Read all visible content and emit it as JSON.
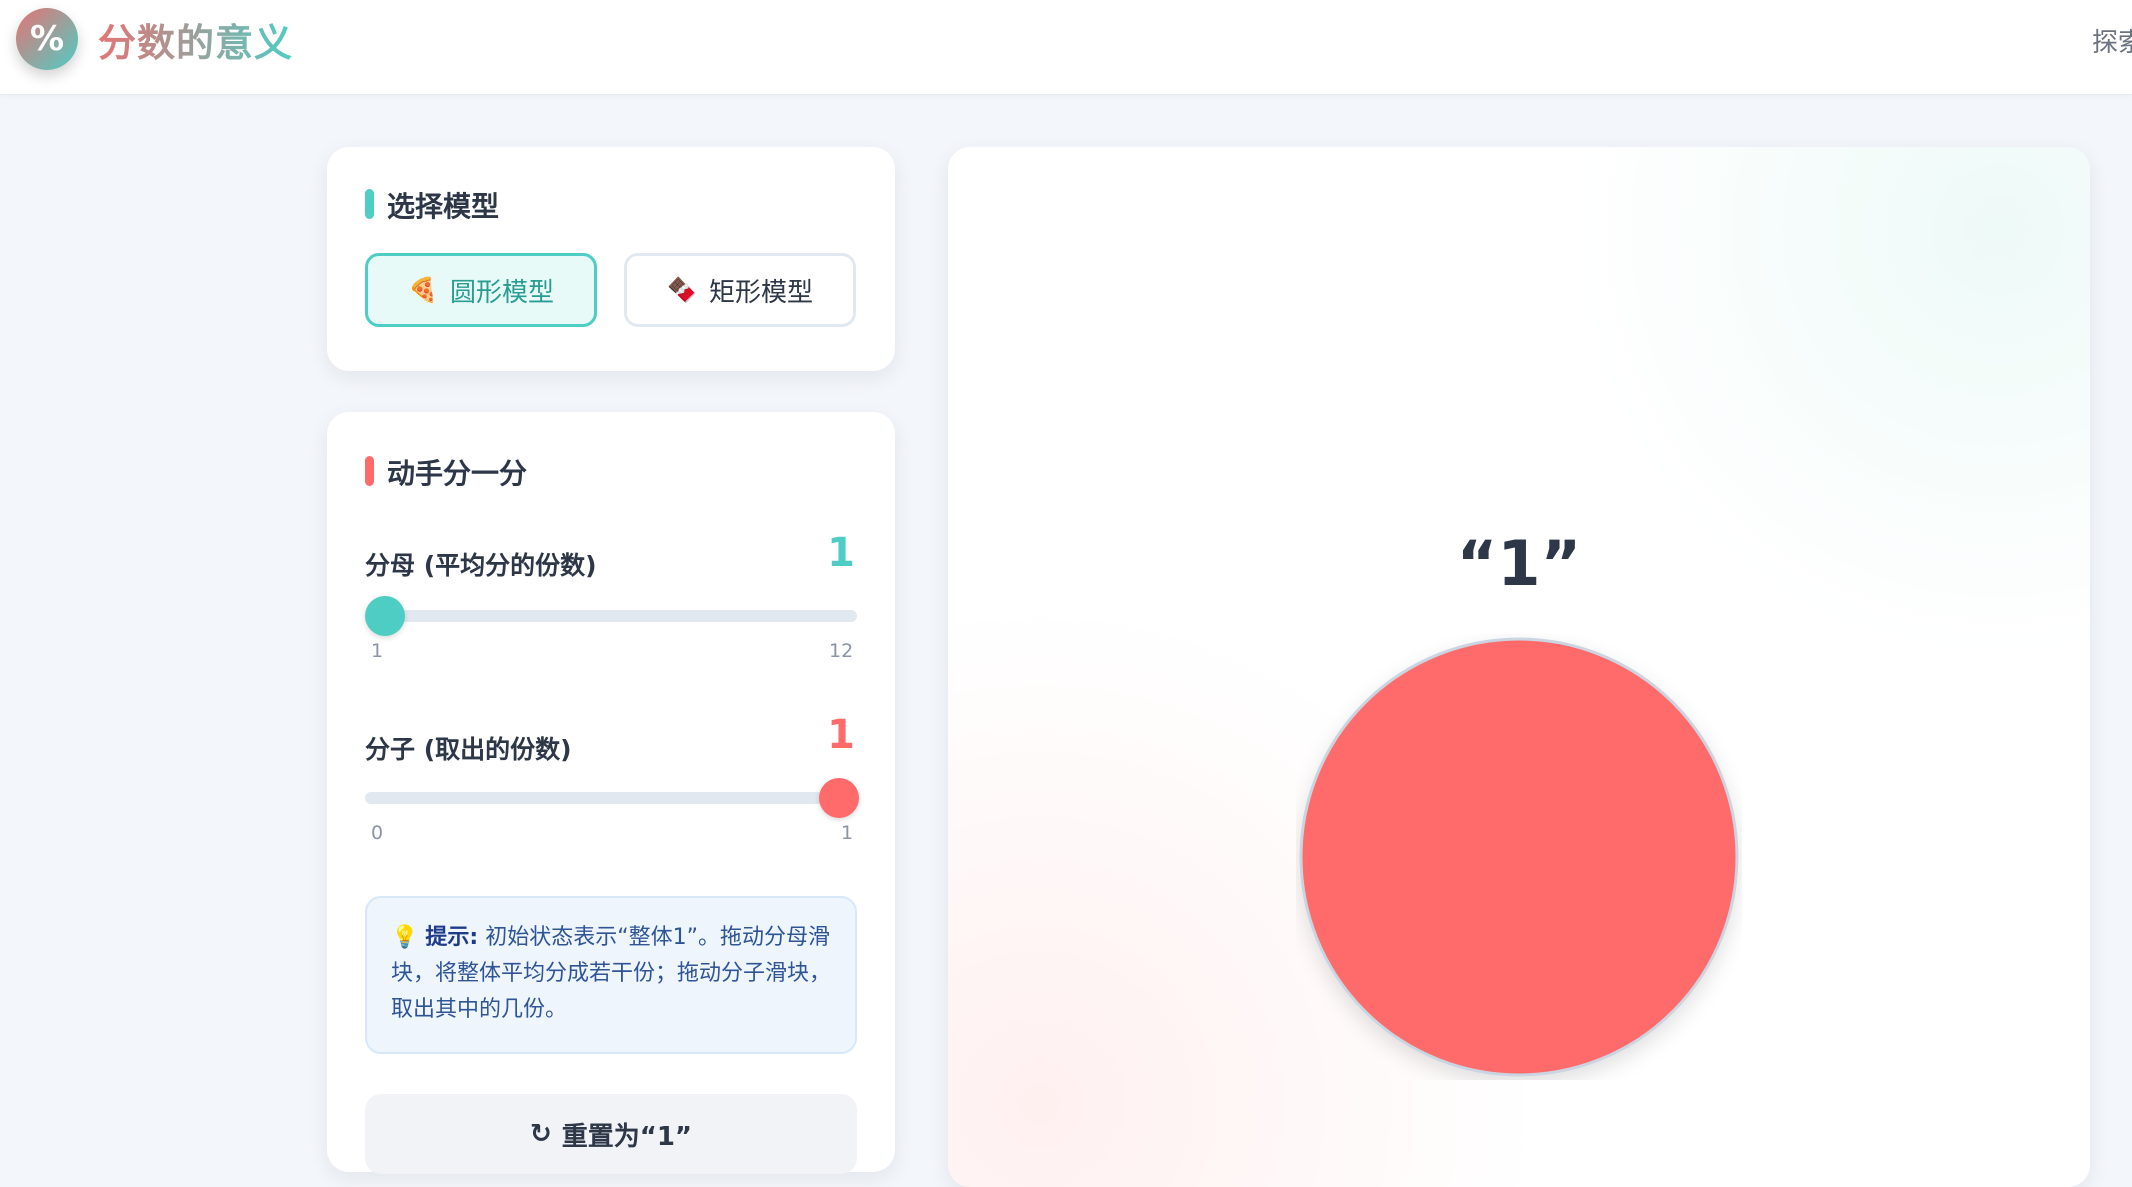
{
  "header": {
    "logo_symbol": "%",
    "title": "分数的意义",
    "nav_link": "探索"
  },
  "model_card": {
    "title": "选择模型",
    "accent_color": "#4ecdc4",
    "buttons": [
      {
        "label": "圆形模型",
        "icon": "pizza-icon",
        "glyph": "🍕",
        "active": true
      },
      {
        "label": "矩形模型",
        "icon": "chocolate-icon",
        "glyph": "🍫",
        "active": false
      }
    ]
  },
  "divide_card": {
    "title": "动手分一分",
    "accent_color": "#ff6b6b",
    "denominator": {
      "label": "分母 (平均分的份数)",
      "value": "1",
      "min": "1",
      "max": "12",
      "color": "#4ecdc4"
    },
    "numerator": {
      "label": "分子 (取出的份数)",
      "value": "1",
      "min": "0",
      "max": "1",
      "color": "#ff6b6b"
    },
    "hint": {
      "icon": "💡",
      "label": "提示:",
      "text": "初始状态表示“整体1”。拖动分母滑块，将整体平均分成若干份；拖动分子滑块，取出其中的几份。"
    },
    "reset_button": {
      "icon": "↻",
      "label": "重置为“1”"
    }
  },
  "view": {
    "fraction_text": "“1”",
    "fill_color": "#ff6b6b",
    "filled_parts": 1,
    "total_parts": 1
  }
}
